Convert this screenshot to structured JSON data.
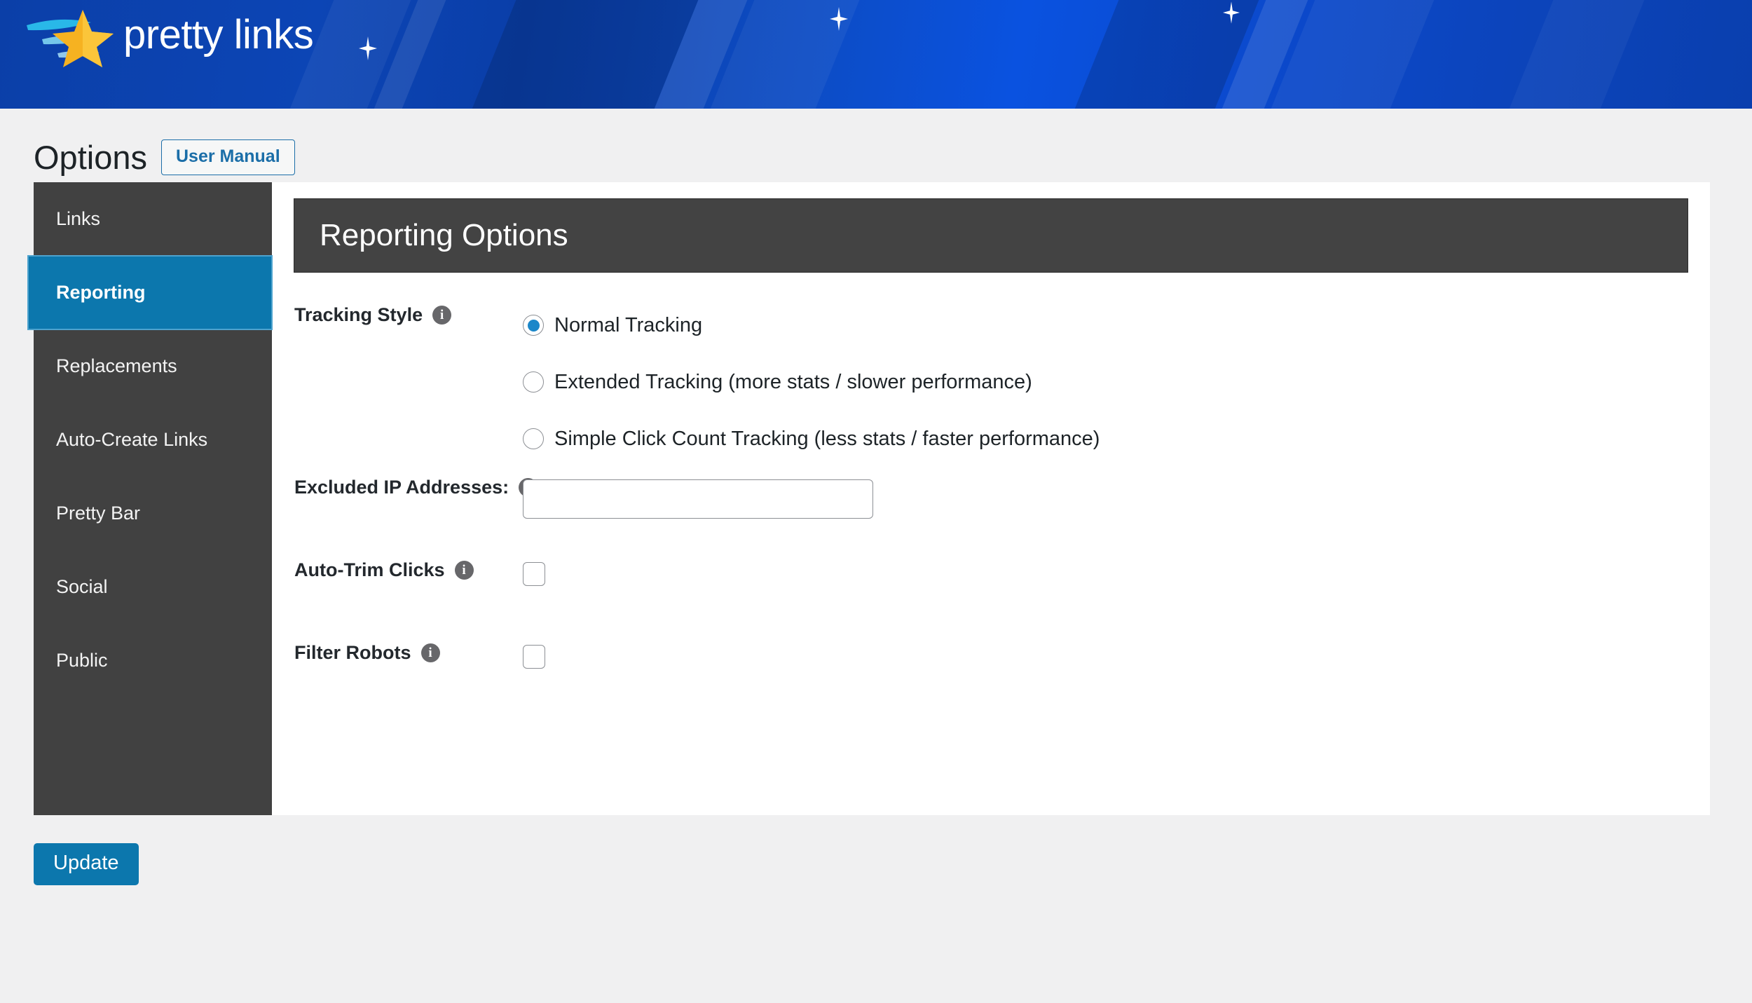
{
  "brand": {
    "logo_text": "pretty links",
    "logo_icon": "star-swoosh-logo",
    "banner_color": "#0c45b5",
    "star_color": "#f6b221",
    "swoosh_color": "#29b8e8"
  },
  "header": {
    "page_title": "Options",
    "user_manual_label": "User Manual",
    "user_manual_accent": "#1b6ea8"
  },
  "sidebar": {
    "active_color": "#0c77ad",
    "background": "#414141",
    "items": [
      {
        "label": "Links",
        "active": false
      },
      {
        "label": "Reporting",
        "active": true
      },
      {
        "label": "Replacements",
        "active": false
      },
      {
        "label": "Auto-Create Links",
        "active": false
      },
      {
        "label": "Pretty Bar",
        "active": false
      },
      {
        "label": "Social",
        "active": false
      },
      {
        "label": "Public",
        "active": false
      }
    ]
  },
  "panel": {
    "title": "Reporting Options",
    "header_background": "#434343"
  },
  "form": {
    "tracking_style": {
      "label": "Tracking Style",
      "info_icon": "info-icon",
      "selected": "Normal Tracking",
      "options": [
        {
          "label": "Normal Tracking",
          "checked": true
        },
        {
          "label": "Extended Tracking (more stats / slower performance)",
          "checked": false
        },
        {
          "label": "Simple Click Count Tracking (less stats / faster performance)",
          "checked": false
        }
      ]
    },
    "excluded_ips": {
      "label": "Excluded IP Addresses:",
      "info_icon": "info-icon",
      "value": "",
      "placeholder": ""
    },
    "auto_trim_clicks": {
      "label": "Auto-Trim Clicks",
      "info_icon": "info-icon",
      "checked": false
    },
    "filter_robots": {
      "label": "Filter Robots",
      "info_icon": "info-icon",
      "checked": false
    }
  },
  "footer": {
    "update_label": "Update",
    "update_color": "#0c77ad"
  }
}
